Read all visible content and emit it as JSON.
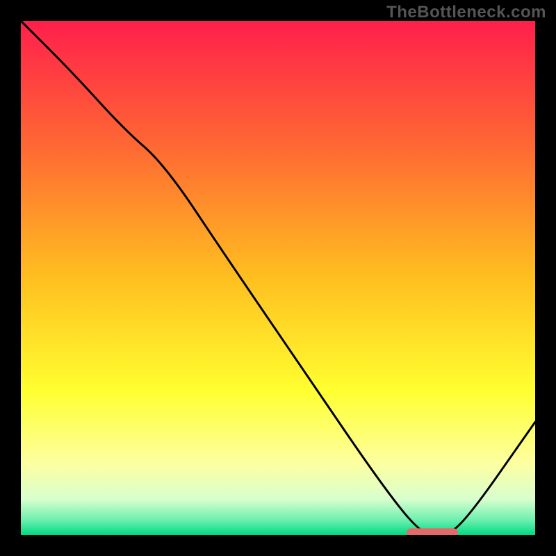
{
  "watermark": "TheBottleneck.com",
  "chart_data": {
    "type": "line",
    "title": "",
    "xlabel": "",
    "ylabel": "",
    "xlim": [
      0,
      100
    ],
    "ylim": [
      0,
      100
    ],
    "background_gradient": {
      "stops": [
        {
          "pos": 0.0,
          "color": "#ff1f4b"
        },
        {
          "pos": 0.25,
          "color": "#ff6a33"
        },
        {
          "pos": 0.5,
          "color": "#ffbf20"
        },
        {
          "pos": 0.72,
          "color": "#ffff30"
        },
        {
          "pos": 0.86,
          "color": "#fdffa0"
        },
        {
          "pos": 0.93,
          "color": "#d8ffce"
        },
        {
          "pos": 0.97,
          "color": "#6ff0b0"
        },
        {
          "pos": 1.0,
          "color": "#00d980"
        }
      ]
    },
    "curve": {
      "x": [
        0,
        10,
        20,
        28,
        40,
        55,
        70,
        78,
        82,
        86,
        100
      ],
      "y": [
        100,
        90,
        79,
        72,
        54,
        32,
        10,
        0,
        0,
        2,
        22
      ]
    },
    "marker": {
      "x_start": 75,
      "x_end": 85,
      "y": 0.5,
      "color": "#e46a6a"
    }
  }
}
